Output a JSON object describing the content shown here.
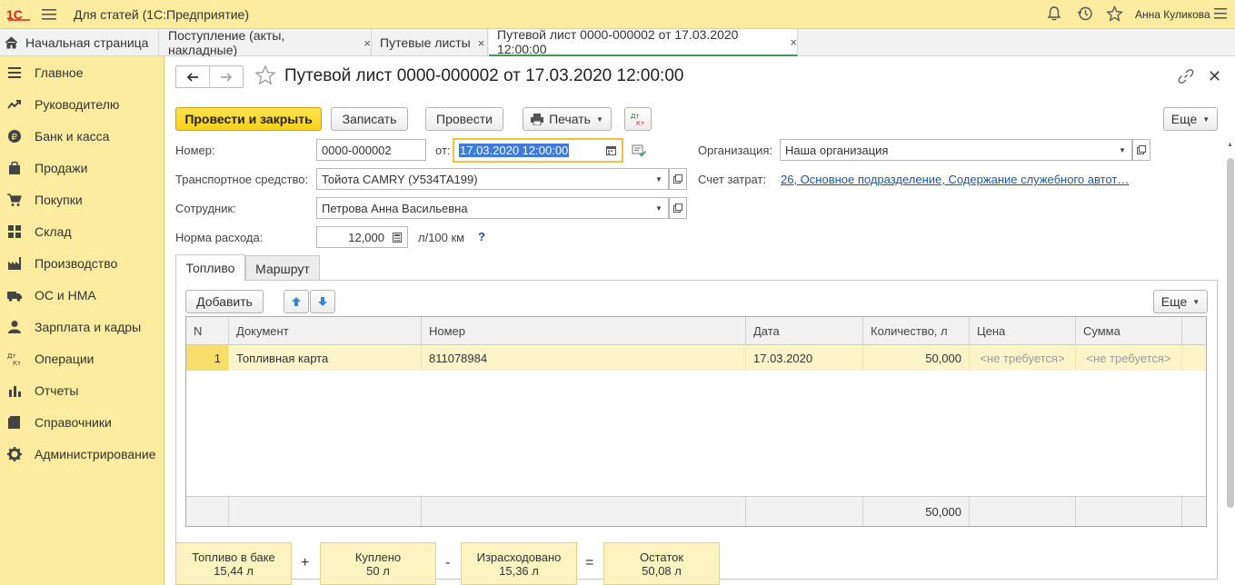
{
  "app": {
    "title": "Для статей  (1С:Предприятие)",
    "user": "Анна Куликова"
  },
  "tabs": {
    "home": "Начальная страница",
    "items": [
      {
        "label": "Поступление (акты, накладные)",
        "close": "×"
      },
      {
        "label": "Путевые листы",
        "close": "×"
      },
      {
        "label": "Путевой лист 0000-000002 от 17.03.2020 12:00:00",
        "close": "×"
      }
    ]
  },
  "sidebar": {
    "items": [
      {
        "label": "Главное",
        "icon": "list-icon"
      },
      {
        "label": "Руководителю",
        "icon": "trend-icon"
      },
      {
        "label": "Банк и касса",
        "icon": "ruble-icon"
      },
      {
        "label": "Продажи",
        "icon": "bag-icon"
      },
      {
        "label": "Покупки",
        "icon": "cart-icon"
      },
      {
        "label": "Склад",
        "icon": "warehouse-icon"
      },
      {
        "label": "Производство",
        "icon": "factory-icon"
      },
      {
        "label": "ОС и НМА",
        "icon": "truck-icon"
      },
      {
        "label": "Зарплата и кадры",
        "icon": "person-icon"
      },
      {
        "label": "Операции",
        "icon": "dt-kt-icon"
      },
      {
        "label": "Отчеты",
        "icon": "bar-chart-icon"
      },
      {
        "label": "Справочники",
        "icon": "book-icon"
      },
      {
        "label": "Администрирование",
        "icon": "gear-icon"
      }
    ]
  },
  "document": {
    "title": "Путевой лист 0000-000002 от 17.03.2020 12:00:00"
  },
  "toolbar": {
    "post_close": "Провести и закрыть",
    "save": "Записать",
    "post": "Провести",
    "print": "Печать",
    "dtkt": "Дт Кт",
    "more": "Еще"
  },
  "form": {
    "number_label": "Номер:",
    "number_value": "0000-000002",
    "date_label": "от:",
    "date_value": "17.03.2020 12:00:00",
    "org_label": "Организация:",
    "org_value": "Наша организация",
    "vehicle_label": "Транспортное средство:",
    "vehicle_value": "Тойота CAMRY (У534ТА199)",
    "cost_account_label": "Счет затрат:",
    "cost_account_value": "26, Основное подразделение, Содержание служебного автот…",
    "employee_label": "Сотрудник:",
    "employee_value": "Петрова Анна Васильевна",
    "norm_label": "Норма расхода:",
    "norm_value": "12,000",
    "norm_unit": "л/100 км",
    "help": "?"
  },
  "inner_tabs": {
    "fuel": "Топливо",
    "route": "Маршрут"
  },
  "table_toolbar": {
    "add": "Добавить",
    "more": "Еще"
  },
  "table": {
    "columns": [
      "N",
      "Документ",
      "Номер",
      "Дата",
      "Количество, л",
      "Цена",
      "Сумма"
    ],
    "rows": [
      {
        "n": "1",
        "doc": "Топливная карта",
        "number": "811078984",
        "date": "17.03.2020",
        "qty": "50,000",
        "price": "<не требуется>",
        "sum": "<не требуется>"
      }
    ],
    "footer_qty": "50,000"
  },
  "summary": {
    "tank_label": "Топливо в баке",
    "tank_value": "15,44 л",
    "plus": "+",
    "bought_label": "Куплено",
    "bought_value": "50 л",
    "minus": "-",
    "used_label": "Израсходовано",
    "used_value": "15,36 л",
    "equals": "=",
    "rest_label": "Остаток",
    "rest_value": "50,08 л"
  },
  "colors": {
    "accent_yellow": "#fbec9f",
    "primary_button": "#f9d217",
    "active_tab_underline": "#3a9b5c",
    "link": "#1a57a0",
    "selection": "#3d7bd8"
  }
}
